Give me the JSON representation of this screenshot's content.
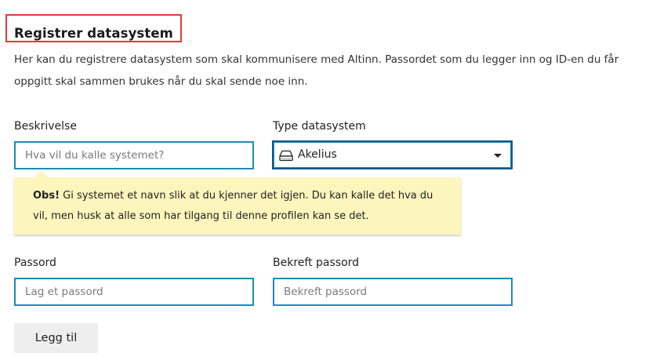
{
  "page": {
    "title": "Registrer datasystem",
    "intro": "Her kan du registrere datasystem som skal kommunisere med Altinn. Passordet som du legger inn og ID-en du får oppgitt skal sammen brukes når du skal sende noe inn."
  },
  "form": {
    "description": {
      "label": "Beskrivelse",
      "placeholder": "Hva vil du kalle systemet?",
      "value": ""
    },
    "system_type": {
      "label": "Type datasystem",
      "selected": "Akelius",
      "icon": "hard-drive-icon"
    },
    "note": {
      "strong": "Obs!",
      "text": " Gi systemet et navn slik at du kjenner det igjen. Du kan kalle det hva du vil, men husk at alle som har tilgang til denne profilen kan se det."
    },
    "password": {
      "label": "Passord",
      "placeholder": "Lag et passord",
      "value": ""
    },
    "confirm_password": {
      "label": "Bekreft passord",
      "placeholder": "Bekreft passord",
      "value": ""
    },
    "submit_label": "Legg til"
  },
  "colors": {
    "highlight_border": "#e0383e",
    "input_border": "#1c8cb6",
    "note_background": "#fcf6bd",
    "button_background": "#eeeeee"
  }
}
